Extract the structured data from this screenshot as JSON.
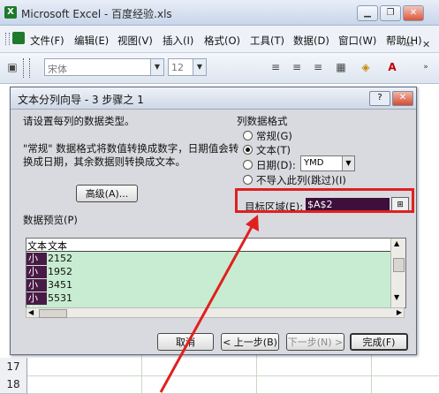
{
  "window": {
    "title": "Microsoft Excel - 百度经验.xls",
    "app_icon": "X"
  },
  "menu": [
    "文件(F)",
    "编辑(E)",
    "视图(V)",
    "插入(I)",
    "格式(O)",
    "工具(T)",
    "数据(D)",
    "窗口(W)",
    "帮助(H)"
  ],
  "toolbar": {
    "font": "宋体",
    "size": "12"
  },
  "rows": [
    "17",
    "18"
  ],
  "dialog": {
    "title": "文本分列向导 - 3 步骤之 1",
    "prompt": "请设置每列的数据类型。",
    "description": "\"常规\" 数据格式将数值转换成数字，日期值会转换成日期，其余数据则转换成文本。",
    "advanced_btn": "高级(A)...",
    "column_format_group": "列数据格式",
    "options": {
      "general": "常规(G)",
      "text": "文本(T)",
      "date": "日期(D):",
      "skip": "不导入此列(跳过)(I)"
    },
    "date_format": "YMD",
    "destination_label": "目标区域(E):",
    "destination_value": "$A$2",
    "preview_label": "数据预览(P)",
    "preview_header": [
      "文本",
      "文本"
    ],
    "preview_rows": [
      [
        "小黄",
        "2152"
      ],
      [
        "小连",
        "1952"
      ],
      [
        "小沈",
        "3451"
      ],
      [
        "小刘",
        "5531"
      ]
    ],
    "buttons": {
      "cancel": "取消",
      "back": "< 上一步(B)",
      "next": "下一步(N) >",
      "finish": "完成(F)"
    }
  },
  "colors": {
    "annotation": "#e0201f",
    "preview_bg": "#c8ecd1",
    "selection": "#4a1a47"
  }
}
